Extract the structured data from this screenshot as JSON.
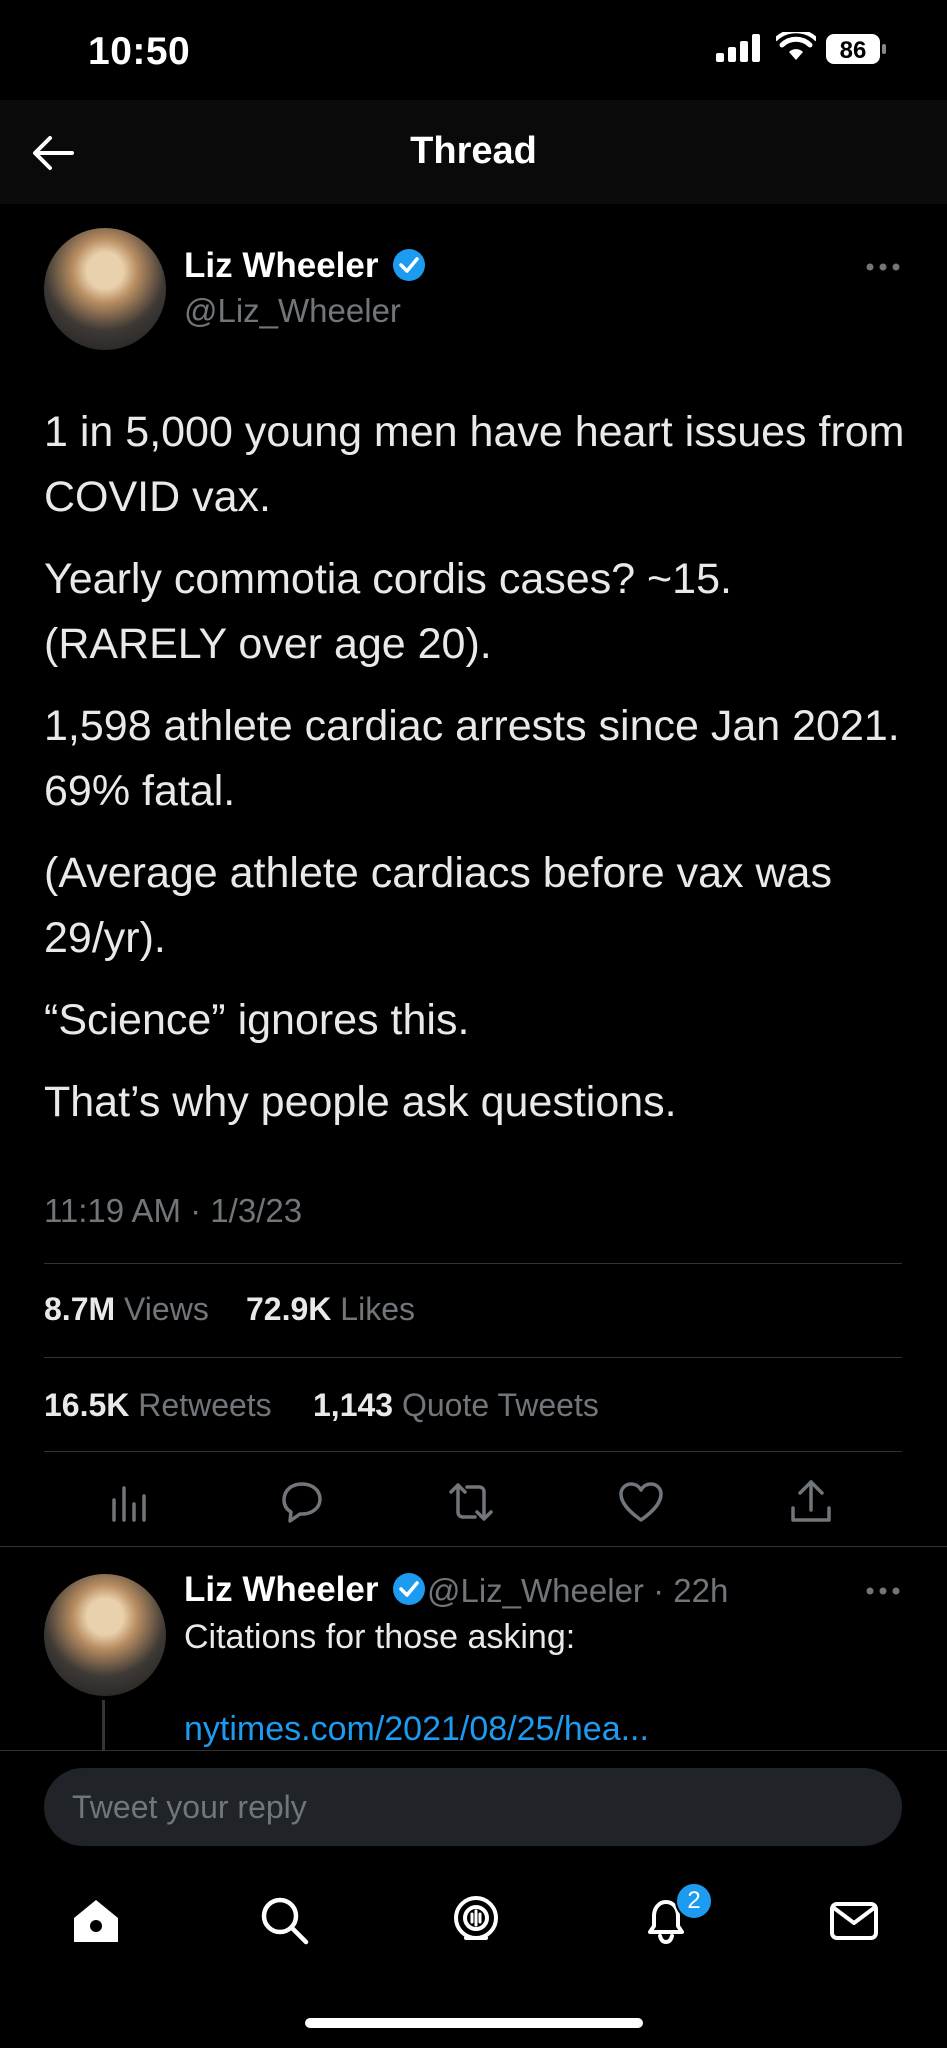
{
  "status_bar": {
    "time": "10:50",
    "battery": "86"
  },
  "nav": {
    "title": "Thread"
  },
  "tweet": {
    "author_name": "Liz Wheeler",
    "author_handle": "@Liz_Wheeler",
    "paragraphs": [
      "1 in 5,000 young men have heart issues from COVID vax.",
      "Yearly commotia cordis cases? ~15. (RARELY over age 20).",
      "1,598 athlete cardiac arrests since Jan 2021. 69% fatal.",
      "(Average athlete cardiacs before vax was 29/yr).",
      "“Science” ignores this.",
      "That’s why people ask questions."
    ],
    "timestamp": "11:19 AM · 1/3/23",
    "stats": {
      "views_count": "8.7M",
      "views_label": "Views",
      "likes_count": "72.9K",
      "likes_label": "Likes",
      "retweets_count": "16.5K",
      "retweets_label": "Retweets",
      "quotes_count": "1,143",
      "quotes_label": "Quote Tweets"
    },
    "actions": [
      "analytics-icon",
      "reply-icon",
      "retweet-icon",
      "like-icon",
      "share-icon"
    ]
  },
  "reply": {
    "author_name": "Liz Wheeler",
    "author_handle_time": "@Liz_Wheeler · 22h",
    "text": "Citations for those asking:",
    "link": "nytimes.com/2021/08/25/hea..."
  },
  "compose": {
    "placeholder": "Tweet your reply"
  },
  "tab_bar": {
    "tabs": [
      "home-icon",
      "search-icon",
      "spaces-icon",
      "notifications-icon",
      "messages-icon"
    ],
    "notifications_badge": "2"
  },
  "colors": {
    "accent": "#1d9bf0",
    "background": "#000000",
    "muted": "#71767b",
    "text": "#e7e9ea"
  }
}
